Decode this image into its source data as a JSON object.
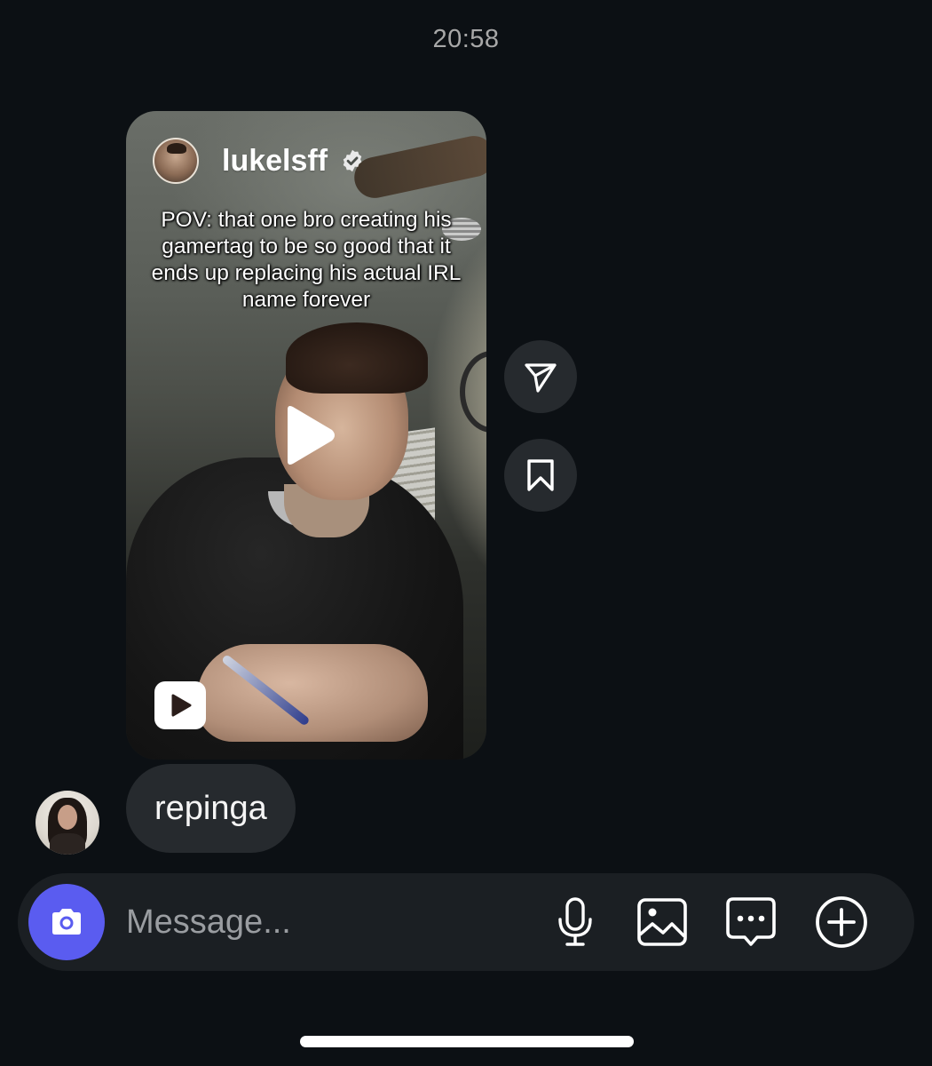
{
  "timestamp": "20:58",
  "shared_reel": {
    "username": "lukelsff",
    "verified": true,
    "caption": "POV: that one bro creating his gamertag to be so good that it ends up replacing his actual IRL name forever",
    "play_icon": "play-icon",
    "reels_icon": "reels-icon"
  },
  "side_actions": {
    "share_icon": "send-icon",
    "save_icon": "bookmark-icon"
  },
  "message": {
    "text": "repinga"
  },
  "composer": {
    "placeholder": "Message...",
    "camera_icon": "camera-icon",
    "mic_icon": "microphone-icon",
    "gallery_icon": "image-icon",
    "sticker_icon": "chat-bubble-icon",
    "add_icon": "plus-circle-icon",
    "accent_color": "#5a5cf0"
  },
  "colors": {
    "background": "#0c1014",
    "bubble": "#262a2e",
    "composer": "#1b1f23"
  }
}
